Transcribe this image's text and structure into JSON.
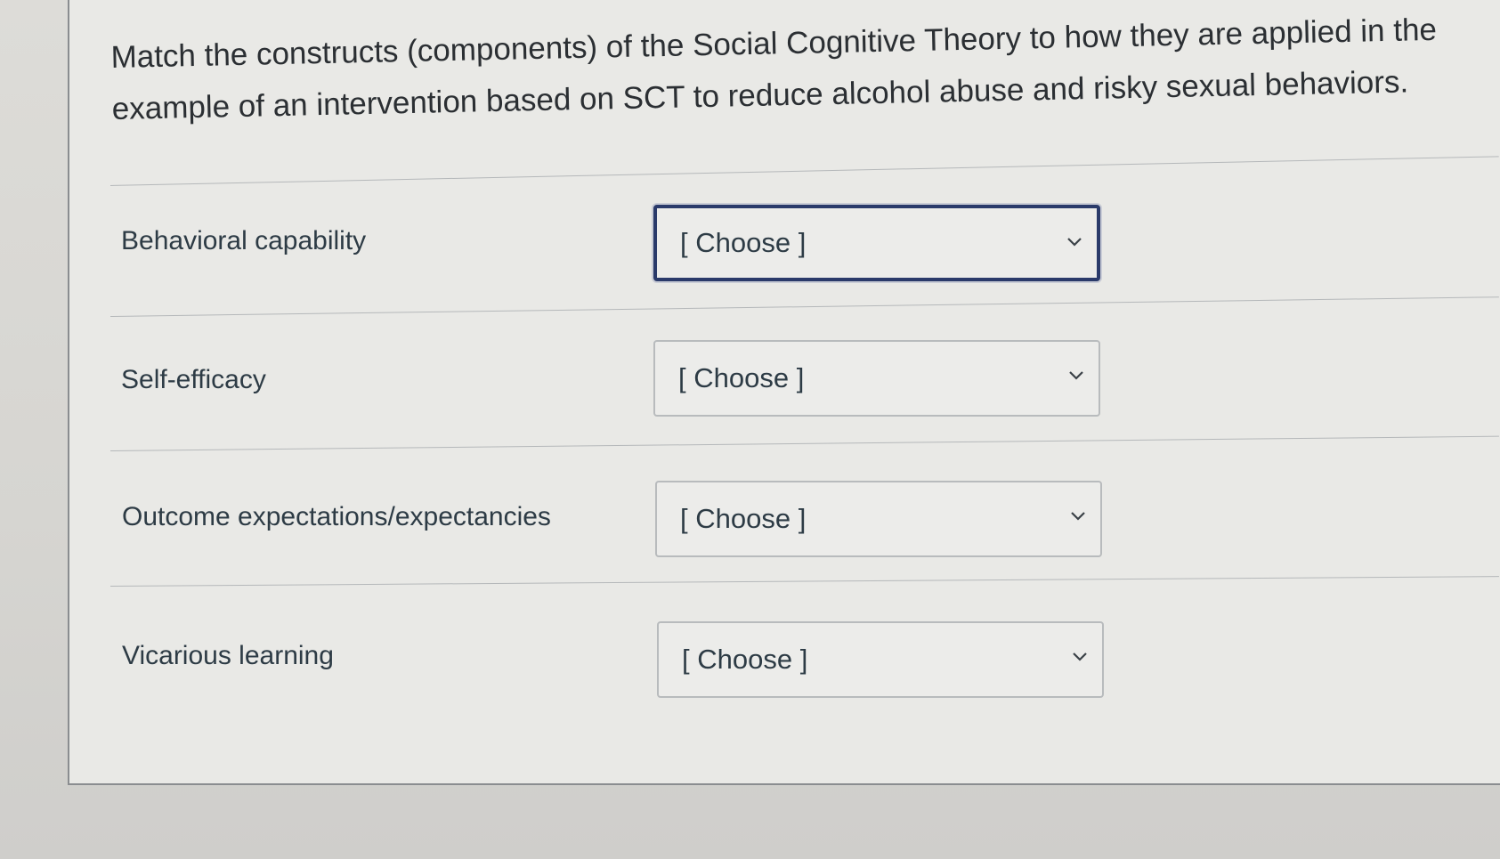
{
  "question": {
    "prompt": "Match the constructs (components) of the Social Cognitive Theory to how they are applied in the example of an intervention based on SCT to reduce alcohol abuse and risky sexual behaviors."
  },
  "matches": [
    {
      "construct": "Behavioral capability",
      "selected": "[ Choose ]",
      "focused": true
    },
    {
      "construct": "Self-efficacy",
      "selected": "[ Choose ]",
      "focused": false
    },
    {
      "construct": "Outcome expectations/expectancies",
      "selected": "[ Choose ]",
      "focused": false
    },
    {
      "construct": "Vicarious learning",
      "selected": "[ Choose ]",
      "focused": false
    }
  ],
  "colors": {
    "focus_border": "#2a3a6a",
    "text": "#2d3b45",
    "card_background": "#e9e9e6"
  },
  "icons": {
    "dropdown": "chevron-down-icon"
  }
}
